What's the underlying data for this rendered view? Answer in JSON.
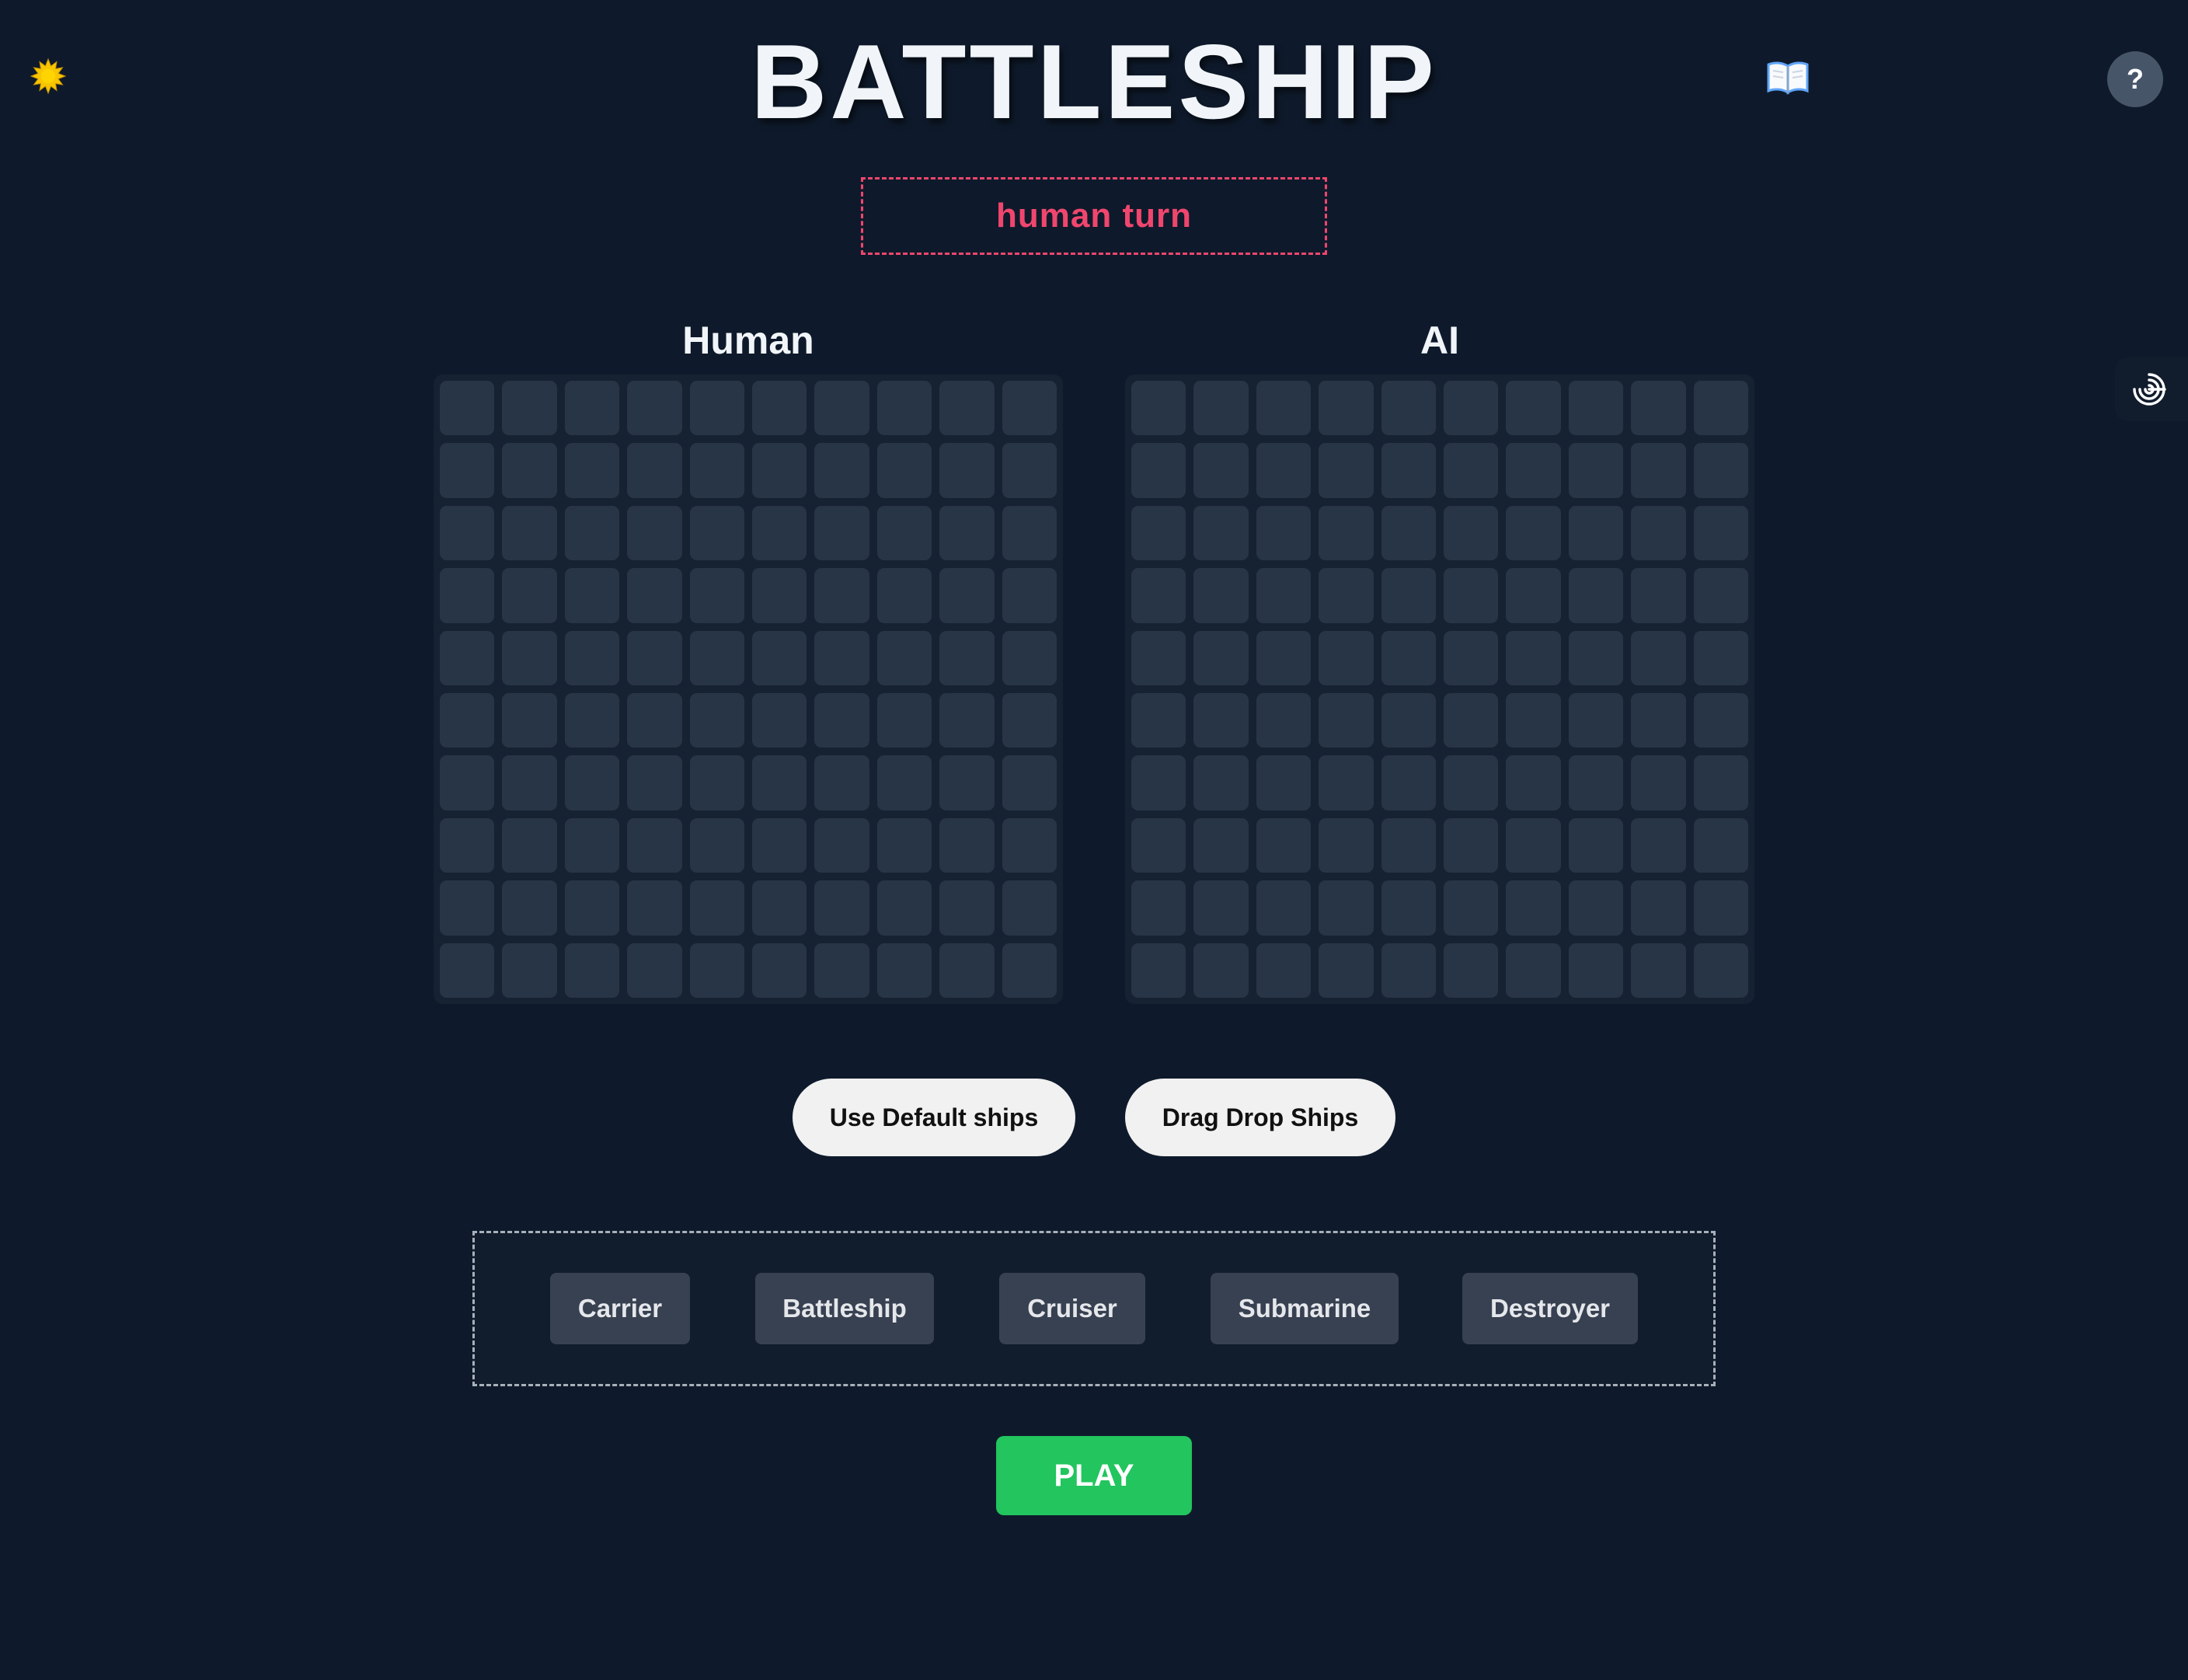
{
  "header": {
    "title": "BATTLESHIP",
    "theme_icon": "sun-icon",
    "rules_icon": "open-book-icon",
    "help_label": "?",
    "side_tab_icon": "spiral-target-icon"
  },
  "status": {
    "turn_text": "human turn"
  },
  "boards": {
    "human_label": "Human",
    "ai_label": "AI",
    "rows": 10,
    "cols": 10
  },
  "controls": {
    "default_ships_label": "Use Default ships",
    "drag_drop_label": "Drag Drop Ships",
    "play_label": "PLAY"
  },
  "ships": [
    "Carrier",
    "Battleship",
    "Cruiser",
    "Submarine",
    "Destroyer"
  ],
  "colors": {
    "background": "#0e1a2b",
    "turn_accent": "#f0466e",
    "cell": "#273546",
    "play": "#22c55e",
    "ship_button": "#374151"
  }
}
